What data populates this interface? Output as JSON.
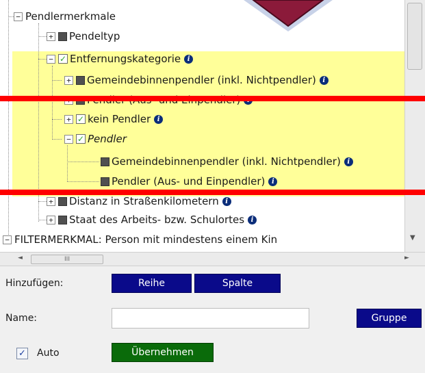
{
  "tree": {
    "items": [
      {
        "label": "Pendlermerkmale",
        "expander": "−",
        "mark": "none",
        "info": false
      },
      {
        "label": "Pendeltyp",
        "expander": "+",
        "mark": "square",
        "info": false
      },
      {
        "label": "Entfernungskategorie",
        "expander": "−",
        "mark": "check",
        "info": true
      },
      {
        "label": "Gemeindebinnenpendler (inkl. Nichtpendler)",
        "expander": "+",
        "mark": "square",
        "info": true
      },
      {
        "label": "Pendler (Aus- und Einpendler)",
        "expander": "+",
        "mark": "square",
        "info": true
      },
      {
        "label": "kein Pendler",
        "expander": "+",
        "mark": "check",
        "info": true
      },
      {
        "label": "Pendler",
        "expander": "−",
        "mark": "check",
        "info": false
      },
      {
        "label": "Gemeindebinnenpendler (inkl. Nichtpendler)",
        "expander": "",
        "mark": "square",
        "info": true
      },
      {
        "label": "Pendler (Aus- und Einpendler)",
        "expander": "",
        "mark": "square",
        "info": true
      },
      {
        "label": "Distanz in Straßenkilometern",
        "expander": "+",
        "mark": "square",
        "info": true
      },
      {
        "label": "Staat des Arbeits- bzw. Schulortes",
        "expander": "+",
        "mark": "square",
        "info": true
      },
      {
        "label": "FILTERMERKMAL: Person mit mindestens einem Kin",
        "expander": "−",
        "mark": "none",
        "info": false
      }
    ],
    "check_glyph": "✓",
    "info_glyph": "i"
  },
  "scrollbar": {
    "thumb_glyph": "III",
    "left_arrow": "◄",
    "right_arrow": "►",
    "down_arrow": "▼"
  },
  "form": {
    "add_label": "Hinzufügen:",
    "row_button": "Reihe",
    "column_button": "Spalte",
    "name_label": "Name:",
    "name_value": "",
    "group_button": "Gruppe",
    "auto_label": "Auto",
    "auto_checked": true,
    "auto_glyph": "✓",
    "apply_button": "Übernehmen"
  },
  "colors": {
    "highlight": "#ffff99",
    "button_navy": "#0a0a8a",
    "button_green": "#0a6b0a",
    "overlay_red": "#ff0000",
    "decor_arrow": "#8b1a3a"
  }
}
